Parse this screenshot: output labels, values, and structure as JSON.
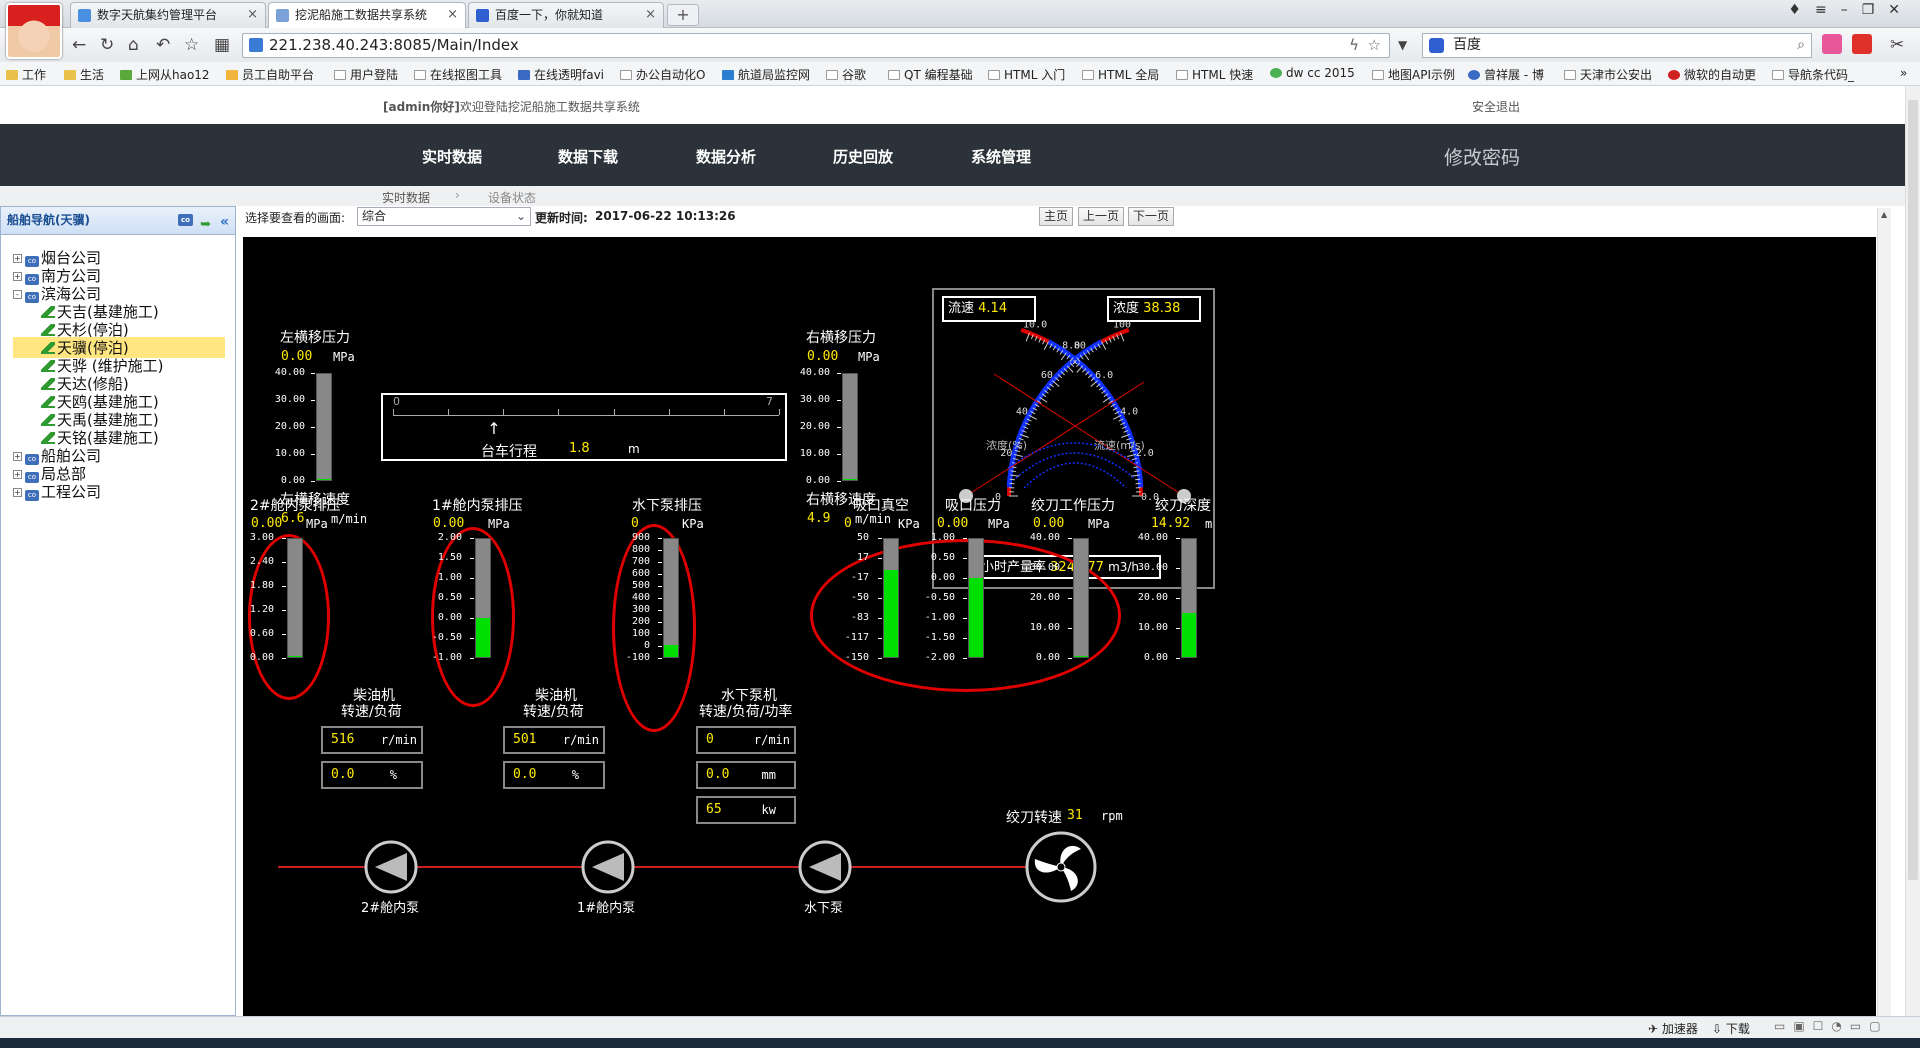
{
  "browser": {
    "tabs": [
      {
        "label": "数字天航集约管理平台"
      },
      {
        "label": "挖泥船施工数据共享系统"
      },
      {
        "label": "百度一下，你就知道"
      }
    ],
    "new_tab": "+",
    "address": "221.238.40.243:8085/Main/Index",
    "search_engine": "百度",
    "bookmarks": [
      "工作",
      "生活",
      "上网从hao12",
      "员工自助平台",
      "用户登陆",
      "在线抠图工具",
      "在线透明favi",
      "办公自动化O",
      "航道局监控网",
      "谷歌",
      "QT 编程基础",
      "HTML 入门",
      "HTML 全局",
      "HTML 快速",
      "dw cc 2015",
      "地图API示例",
      "曾祥展 - 博",
      "天津市公安出",
      "微软的自动更",
      "导航条代码_"
    ],
    "status_items": [
      "加速器",
      "下载"
    ]
  },
  "header": {
    "welcome_user": "[admin你好]",
    "welcome_text": "欢迎登陆挖泥船施工数据共享系统",
    "logout": "安全退出"
  },
  "menu": {
    "items": [
      "实时数据",
      "数据下载",
      "数据分析",
      "历史回放",
      "系统管理"
    ],
    "change_password": "修改密码"
  },
  "breadcrumb": [
    "实时数据",
    "设备状态"
  ],
  "sidebar": {
    "title": "船舶导航(天骥)",
    "co_badge": "co",
    "tree": [
      {
        "label": "烟台公司",
        "expander": "+",
        "level": 0,
        "type": "company"
      },
      {
        "label": "南方公司",
        "expander": "+",
        "level": 0,
        "type": "company"
      },
      {
        "label": "滨海公司",
        "expander": "-",
        "level": 0,
        "type": "company"
      },
      {
        "label": "天吉(基建施工)",
        "level": 1,
        "type": "ship"
      },
      {
        "label": "天杉(停泊)",
        "level": 1,
        "type": "ship"
      },
      {
        "label": "天骥(停泊)",
        "level": 1,
        "type": "ship",
        "selected": true
      },
      {
        "label": "天骅 (维护施工)",
        "level": 1,
        "type": "ship"
      },
      {
        "label": "天达(修船)",
        "level": 1,
        "type": "ship"
      },
      {
        "label": "天鸥(基建施工)",
        "level": 1,
        "type": "ship"
      },
      {
        "label": "天禹(基建施工)",
        "level": 1,
        "type": "ship"
      },
      {
        "label": "天铭(基建施工)",
        "level": 1,
        "type": "ship"
      },
      {
        "label": "船舶公司",
        "expander": "+",
        "level": 0,
        "type": "company"
      },
      {
        "label": "局总部",
        "expander": "+",
        "level": 0,
        "type": "company"
      },
      {
        "label": "工程公司",
        "expander": "+",
        "level": 0,
        "type": "company"
      }
    ]
  },
  "controls": {
    "select_label": "选择要查看的画面:",
    "select_value": "综合",
    "update_label": "更新时间:",
    "update_time": "2017-06-22 10:13:26",
    "buttons": [
      "主页",
      "上一页",
      "下一页"
    ]
  },
  "scada": {
    "colors": {
      "gauge_fill": "#00e000",
      "value": "#ffeb00",
      "annotation": "#e00000"
    },
    "left_traverse": {
      "label": "左横移压力",
      "value": "0.00",
      "unit": "MPa",
      "ticks": [
        "40.00",
        "30.00",
        "20.00",
        "10.00",
        "0.00"
      ],
      "fill": 0.0
    },
    "right_traverse": {
      "label": "右横移压力",
      "value": "0.00",
      "unit": "MPa",
      "ticks": [
        "40.00",
        "30.00",
        "20.00",
        "10.00",
        "0.00"
      ],
      "fill": 0.0
    },
    "trolley": {
      "label": "台车行程",
      "value": "1.8",
      "unit": "m",
      "min": "0",
      "max": "7",
      "position": 1.8
    },
    "left_speed": {
      "label": "左横移速度",
      "value": "6.6",
      "unit": "m/min"
    },
    "right_speed": {
      "label": "右横移速度",
      "value": "4.9",
      "unit": "m/min"
    },
    "dial": {
      "flow_label": "流速",
      "flow_value": "4.14",
      "density_label": "浓度",
      "density_value": "38.38",
      "production_label": "小时产量率",
      "production_value": "3245.77",
      "production_unit": "m3/h",
      "left_scale_name": "浓度(%)",
      "right_scale_name": "流速(m/s)",
      "density_ticks": [
        "0",
        "20",
        "40",
        "60",
        "80",
        "100"
      ],
      "flow_ticks": [
        "0.0",
        "2.0",
        "4.0",
        "6.0",
        "8.0",
        "10.0"
      ]
    },
    "pumps_pressure": [
      {
        "label": "2#舱内泵排压",
        "value": "0.00",
        "unit": "MPa",
        "ticks": [
          "3.00",
          "2.40",
          "1.80",
          "1.20",
          "0.60",
          "0.00"
        ],
        "fill": 0.0
      },
      {
        "label": "1#舱内泵排压",
        "value": "0.00",
        "unit": "MPa",
        "ticks": [
          "2.00",
          "1.50",
          "1.00",
          "0.50",
          "0.00",
          "-0.50",
          "-1.00"
        ],
        "fill": 0.33
      },
      {
        "label": "水下泵排压",
        "value": "0",
        "unit": "KPa",
        "ticks": [
          "900",
          "800",
          "700",
          "600",
          "500",
          "400",
          "300",
          "200",
          "100",
          "0",
          "-100"
        ],
        "fill": 0.1
      }
    ],
    "engines": [
      {
        "label1": "柴油机",
        "label2": "转速/负荷",
        "speed": "516",
        "speed_unit": "r/min",
        "load": "0.0",
        "load_unit": "%"
      },
      {
        "label1": "柴油机",
        "label2": "转速/负荷",
        "speed": "501",
        "speed_unit": "r/min",
        "load": "0.0",
        "load_unit": "%"
      },
      {
        "label1": "水下泵机",
        "label2": "转速/负荷/功率",
        "speed": "0",
        "speed_unit": "r/min",
        "load": "0.0",
        "load_unit": "mm",
        "power": "65",
        "power_unit": "kw"
      }
    ],
    "suction": [
      {
        "label": "吸口真空",
        "value": "0",
        "unit": "KPa",
        "ticks": [
          "50",
          "17",
          "-17",
          "-50",
          "-83",
          "-117",
          "-150"
        ],
        "fill": 0.74
      },
      {
        "label": "吸口压力",
        "value": "0.00",
        "unit": "MPa",
        "ticks": [
          "1.00",
          "0.50",
          "0.00",
          "-0.50",
          "-1.00",
          "-1.50",
          "-2.00"
        ],
        "fill": 0.67
      },
      {
        "label": "绞刀工作压力",
        "value": "0.00",
        "unit": "MPa",
        "ticks": [
          "40.00",
          "30.00",
          "20.00",
          "10.00",
          "0.00"
        ],
        "fill": 0.0
      },
      {
        "label": "绞刀深度",
        "value": "14.92",
        "unit": "m",
        "ticks": [
          "40.00",
          "30.00",
          "20.00",
          "10.00",
          "0.00"
        ],
        "fill": 0.37
      }
    ],
    "cutter_speed": {
      "label": "绞刀转速",
      "value": "31",
      "unit": "rpm"
    },
    "pump_icons": [
      "2#舱内泵",
      "1#舱内泵",
      "水下泵"
    ]
  }
}
